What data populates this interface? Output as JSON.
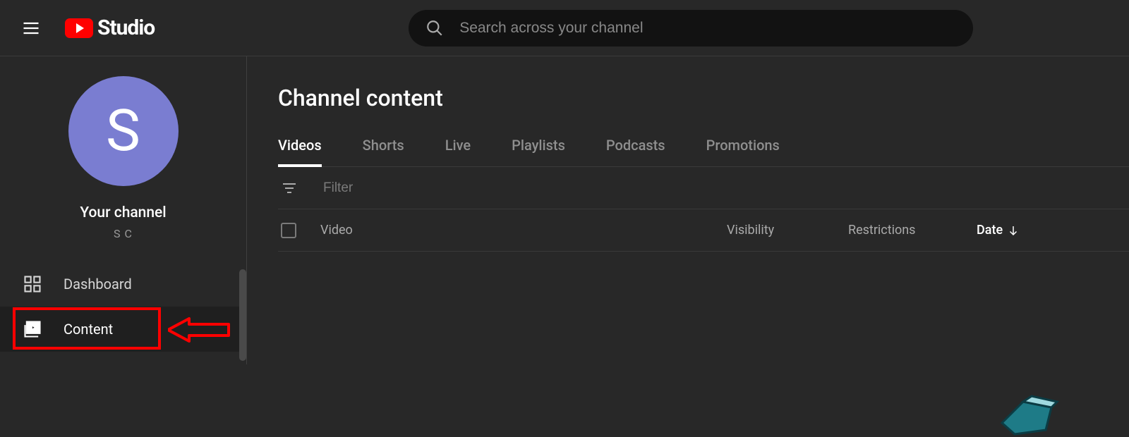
{
  "header": {
    "logo_text": "Studio",
    "search_placeholder": "Search across your channel"
  },
  "sidebar": {
    "avatar_initial": "S",
    "channel_label": "Your channel",
    "channel_name": "S C",
    "items": [
      {
        "id": "dashboard",
        "label": "Dashboard",
        "active": false
      },
      {
        "id": "content",
        "label": "Content",
        "active": true
      }
    ]
  },
  "main": {
    "title": "Channel content",
    "tabs": [
      {
        "id": "videos",
        "label": "Videos",
        "active": true
      },
      {
        "id": "shorts",
        "label": "Shorts",
        "active": false
      },
      {
        "id": "live",
        "label": "Live",
        "active": false
      },
      {
        "id": "playlists",
        "label": "Playlists",
        "active": false
      },
      {
        "id": "podcasts",
        "label": "Podcasts",
        "active": false
      },
      {
        "id": "promotions",
        "label": "Promotions",
        "active": false
      }
    ],
    "filter_placeholder": "Filter",
    "columns": {
      "video": "Video",
      "visibility": "Visibility",
      "restrictions": "Restrictions",
      "date": "Date"
    }
  }
}
